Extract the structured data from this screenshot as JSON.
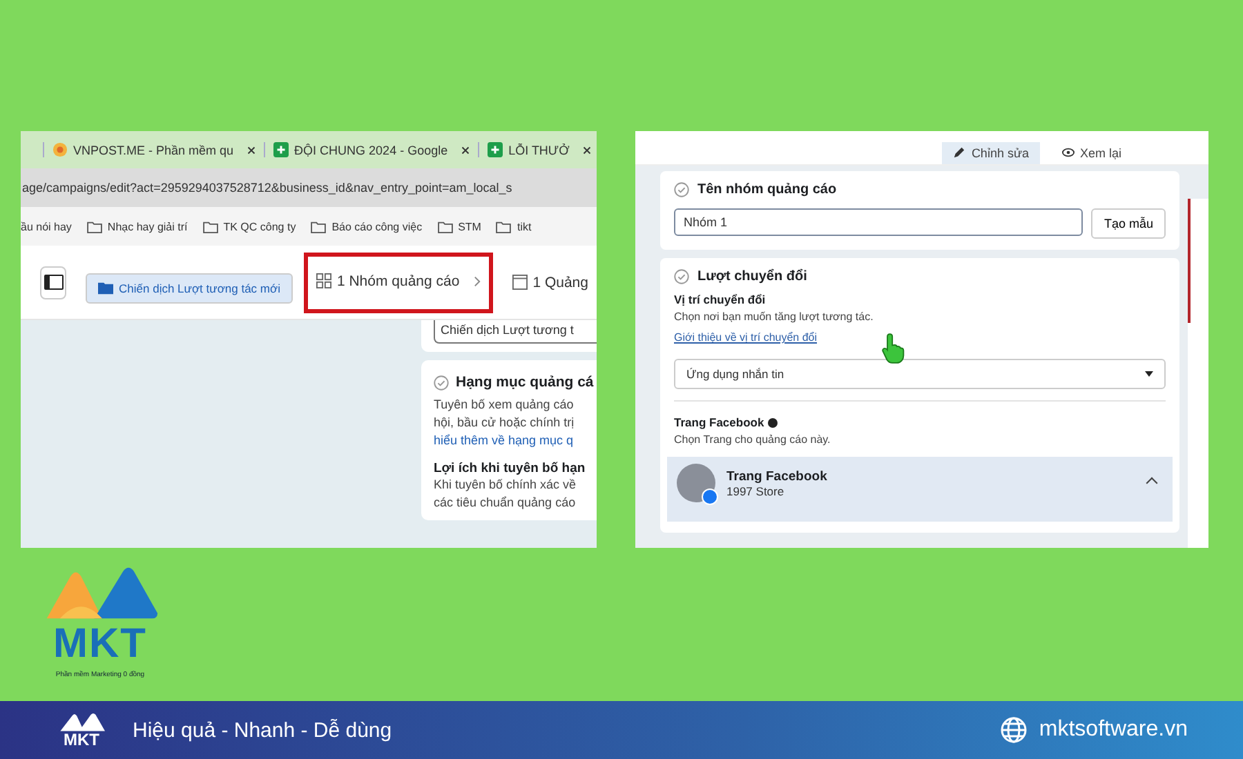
{
  "left_screenshot": {
    "browser_tabs": [
      {
        "title": "VNPOST.ME - Phần mềm qu",
        "kind": "site"
      },
      {
        "title": "ĐỘI CHUNG 2024 - Google",
        "kind": "sheet"
      },
      {
        "title": "LỖI THƯỞ",
        "kind": "sheet"
      }
    ],
    "address": "age/campaigns/edit?act=2959294037528712&business_id&nav_entry_point=am_local_s",
    "bookmarks": [
      {
        "label": "ầu nói hay",
        "kind": "plain"
      },
      {
        "label": "Nhạc hay giải trí",
        "kind": "folder"
      },
      {
        "label": "TK QC công ty",
        "kind": "folder"
      },
      {
        "label": "Báo cáo công việc",
        "kind": "folder"
      },
      {
        "label": "STM",
        "kind": "folder"
      },
      {
        "label": "tikt",
        "kind": "folder"
      }
    ],
    "breadcrumbs": [
      {
        "label": "Chiến dịch Lượt tương tác mới",
        "kind": "campaign",
        "selected": true,
        "highlighted": false
      },
      {
        "label": "1 Nhóm quảng cáo",
        "kind": "adset",
        "selected": false,
        "highlighted": true
      },
      {
        "label": "1 Quảng",
        "kind": "ad",
        "selected": false,
        "highlighted": false
      }
    ],
    "campaign_name_value": "Chiến dịch Lượt tương t",
    "category_title": "Hạng mục quảng cá",
    "category_lines": [
      "Tuyên bố xem quảng cáo",
      "hội, bầu cử hoặc chính trị"
    ],
    "category_link": "hiểu thêm về hạng mục q",
    "benefit_title": "Lợi ích khi tuyên bố hạn",
    "benefit_lines": [
      "Khi tuyên bố chính xác về",
      "các tiêu chuẩn quảng cáo"
    ]
  },
  "right_screenshot": {
    "top_buttons": [
      "Chỉnh sửa",
      "Xem lại"
    ],
    "adset_name_title": "Tên nhóm quảng cáo",
    "adset_name_value": "Nhóm 1",
    "template_button": "Tạo mẫu",
    "conversion_title": "Lượt chuyển đổi",
    "conversion_location_label": "Vị trí chuyển đổi",
    "conversion_location_help": "Chọn nơi bạn muốn tăng lượt tương tác.",
    "conversion_location_link": "Giới thiệu về vị trí chuyển đổi",
    "conversion_location_value": "Ứng dụng nhắn tin",
    "page_title": "Trang Facebook",
    "page_help": "Chọn Trang cho quảng cáo này.",
    "page_card": {
      "title": "Trang Facebook",
      "name": "1997 Store",
      "expanded": true
    }
  },
  "logo": {
    "brand": "MKT",
    "tagline": "Phần mềm Marketing 0 đồng"
  },
  "footer": {
    "brand": "MKT",
    "slogan": "Hiệu quả - Nhanh - Dễ dùng",
    "website": "mktsoftware.vn"
  }
}
